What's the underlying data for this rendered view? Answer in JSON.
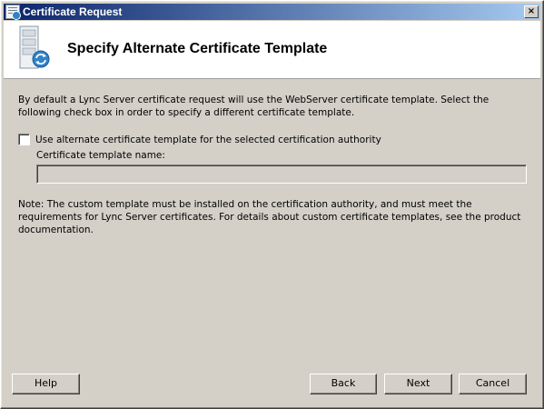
{
  "window": {
    "title": "Certificate Request",
    "close_label": "×"
  },
  "header": {
    "title": "Specify Alternate Certificate Template"
  },
  "main": {
    "intro_text": "By default a Lync Server certificate request will use the WebServer certificate template. Select the following check box in order to specify a different certificate template.",
    "checkbox_label": "Use alternate certificate template for the selected certification authority",
    "checkbox_checked": false,
    "template_field_label": "Certificate template name:",
    "template_field_value": "",
    "note_text": "Note: The custom template must be installed on the certification authority, and must meet the requirements for Lync Server certificates. For details about custom certificate templates, see the product documentation."
  },
  "footer": {
    "help_label": "Help",
    "back_label": "Back",
    "next_label": "Next",
    "cancel_label": "Cancel"
  },
  "colors": {
    "titlebar_start": "#0a246a",
    "titlebar_end": "#a6caf0",
    "dialog_bg": "#d4d0c8",
    "header_bg": "#ffffff"
  },
  "icons": {
    "app": "certificate-app-icon",
    "wizard": "server-certificate-icon"
  }
}
